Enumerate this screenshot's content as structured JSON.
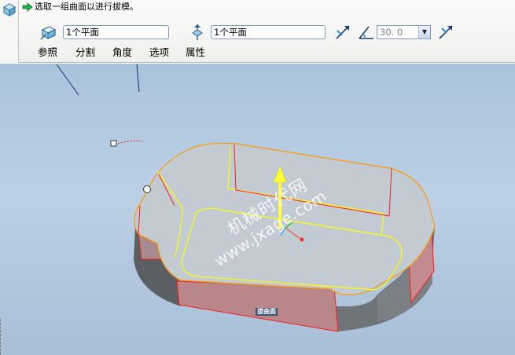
{
  "prompt": {
    "text": "选取一组曲面以进行拔模。",
    "icon": "green-arrow-icon"
  },
  "toolbar": {
    "feature_icon": "draft-feature-icon",
    "surfaces_icon": "draft-surfaces-icon",
    "draft_surfaces_value": "1个平面",
    "hinge_icon": "draft-hinge-icon",
    "draft_hinge_value": "1个平面",
    "flip_pull_icon": "flip-direction-icon",
    "angle_icon": "draft-angle-icon",
    "angle_value": "30. 0",
    "angle_dropdown_icon": "dropdown-arrow-icon",
    "flip_angle_icon": "flip-angle-icon"
  },
  "tabs": [
    {
      "label": "参照"
    },
    {
      "label": "分割"
    },
    {
      "label": "角度"
    },
    {
      "label": "选项"
    },
    {
      "label": "属性"
    }
  ],
  "graphics": {
    "watermark_cn": "机械时代网",
    "watermark_url": "www.jxage.com",
    "surface_label": "拔曲面"
  },
  "colors": {
    "background_top": "#a9c3dd",
    "edge_highlight": "#ffff00",
    "selected_surface": "#ff0000",
    "pull_arrow": "#ffff33",
    "outline": "#ff9900"
  }
}
